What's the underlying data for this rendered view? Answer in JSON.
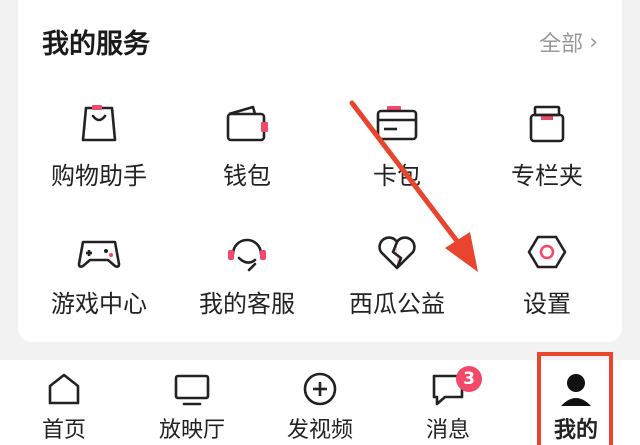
{
  "services": {
    "title": "我的服务",
    "all_label": "全部",
    "items": [
      {
        "label": "购物助手",
        "icon": "shopping-bag-icon"
      },
      {
        "label": "钱包",
        "icon": "wallet-icon"
      },
      {
        "label": "卡包",
        "icon": "card-icon"
      },
      {
        "label": "专栏夹",
        "icon": "folder-icon"
      },
      {
        "label": "游戏中心",
        "icon": "gamepad-icon"
      },
      {
        "label": "我的客服",
        "icon": "headset-icon"
      },
      {
        "label": "西瓜公益",
        "icon": "heart-icon"
      },
      {
        "label": "设置",
        "icon": "settings-icon"
      }
    ]
  },
  "tabbar": {
    "tabs": [
      {
        "label": "首页",
        "icon": "home-icon"
      },
      {
        "label": "放映厅",
        "icon": "tv-icon"
      },
      {
        "label": "发视频",
        "icon": "plus-circle-icon"
      },
      {
        "label": "消息",
        "icon": "message-icon",
        "badge": "3"
      },
      {
        "label": "我的",
        "icon": "user-icon"
      }
    ]
  },
  "colors": {
    "accent": "#f24968",
    "annotation": "#e8442e"
  }
}
